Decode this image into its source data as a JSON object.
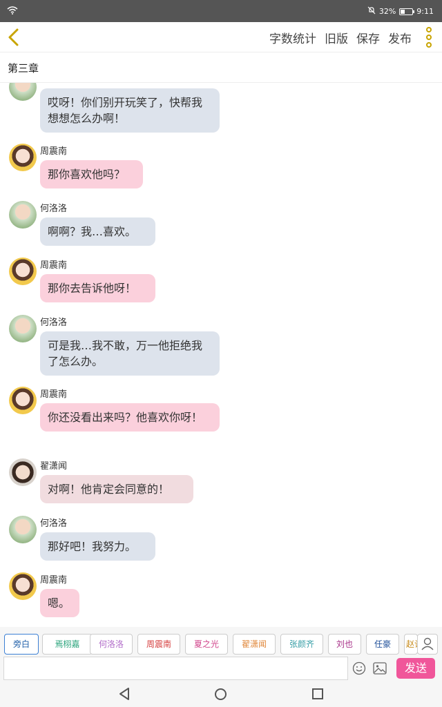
{
  "status": {
    "battery": "32%",
    "time": "9:11"
  },
  "toolbar": {
    "actions": [
      "字数统计",
      "旧版",
      "保存",
      "发布"
    ]
  },
  "chapter": {
    "title": "第三章"
  },
  "messages": [
    {
      "name": "",
      "text": "哎呀！你们别开玩笑了，快帮我想想怎么办啊！",
      "style": "blue",
      "avatar": "green"
    },
    {
      "name": "周震南",
      "text": "那你喜欢他吗？",
      "style": "pink",
      "avatar": "orange"
    },
    {
      "name": "何洛洛",
      "text": "啊啊？我…喜欢。",
      "style": "blue",
      "avatar": "green"
    },
    {
      "name": "周震南",
      "text": "那你去告诉他呀！",
      "style": "pink",
      "avatar": "orange"
    },
    {
      "name": "何洛洛",
      "text": "可是我…我不敢，万一他拒绝我了怎么办。",
      "style": "blue",
      "avatar": "green"
    },
    {
      "name": "周震南",
      "text": "你还没看出来吗？他喜欢你呀！",
      "style": "pink",
      "avatar": "orange"
    },
    {
      "name": "翟潇闻",
      "text": "对啊！他肯定会同意的！",
      "style": "rose",
      "avatar": "gray"
    },
    {
      "name": "何洛洛",
      "text": "那好吧！我努力。",
      "style": "blue",
      "avatar": "green"
    },
    {
      "name": "周震南",
      "text": "嗯。",
      "style": "pink",
      "avatar": "orange"
    }
  ],
  "roles": [
    {
      "label": "旁白",
      "color": "#1c5da8"
    },
    {
      "label": "焉栩嘉",
      "color": "#27a37a"
    },
    {
      "label": "何洛洛",
      "color": "#b06ac8"
    },
    {
      "label": "周震南",
      "color": "#d64141"
    },
    {
      "label": "夏之光",
      "color": "#d2478d"
    },
    {
      "label": "翟潇闻",
      "color": "#e0873a"
    },
    {
      "label": "张颜齐",
      "color": "#3aa0a8"
    },
    {
      "label": "刘也",
      "color": "#a83289"
    },
    {
      "label": "任豪",
      "color": "#1f4f99"
    },
    {
      "label": "赵让",
      "color": "#c78a1a"
    }
  ],
  "input": {
    "value": "",
    "placeholder": ""
  },
  "send": {
    "label": "发送"
  },
  "colors": {
    "accent": "#f0569a",
    "menu_dots": "#c8a400",
    "blue_bubble": "#dde3ec",
    "pink_bubble": "#fbd0dc",
    "rose_bubble": "#f1dcdf"
  }
}
